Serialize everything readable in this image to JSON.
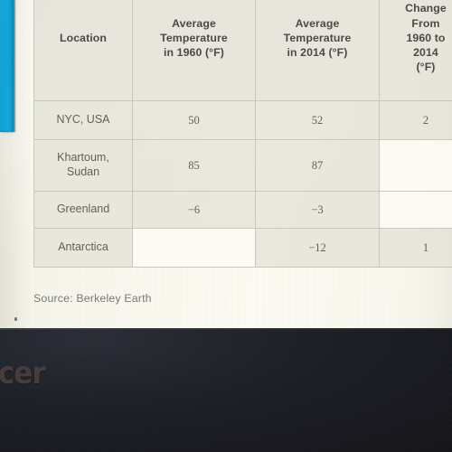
{
  "photo": {
    "surface": "textbook-page",
    "page_bg_color": "#f6f5ed",
    "bezel_color": "#1c1e26",
    "blue_strip_color": "#13a3d6"
  },
  "table": {
    "headers": [
      "Location",
      "Average Temperature in 1960 (°F)",
      "Average Temperature in 2014 (°F)",
      "Change From 1960 to 2014 (°F)"
    ],
    "header_lines": {
      "location": [
        "Location"
      ],
      "avg_1960": [
        "Average",
        "Temperature",
        "in 1960 (°F)"
      ],
      "avg_2014": [
        "Average",
        "Temperature",
        "in 2014 (°F)"
      ],
      "change": [
        "Change",
        "From",
        "1960 to",
        "2014",
        "(°F)"
      ]
    },
    "rows": [
      {
        "location_lines": [
          "NYC, USA"
        ],
        "location": "NYC, USA",
        "avg_1960": "50",
        "avg_2014": "52",
        "change": "2"
      },
      {
        "location_lines": [
          "Khartoum,",
          "Sudan"
        ],
        "location": "Khartoum, Sudan",
        "avg_1960": "85",
        "avg_2014": "87",
        "change": ""
      },
      {
        "location_lines": [
          "Greenland"
        ],
        "location": "Greenland",
        "avg_1960": "−6",
        "avg_2014": "−3",
        "change": ""
      },
      {
        "location_lines": [
          "Antarctica"
        ],
        "location": "Antarctica",
        "avg_1960": "",
        "avg_2014": "−12",
        "change": "1"
      }
    ]
  },
  "caption": {
    "source": "Source: Berkeley Earth"
  },
  "hardware": {
    "brand_logo": "acer"
  }
}
